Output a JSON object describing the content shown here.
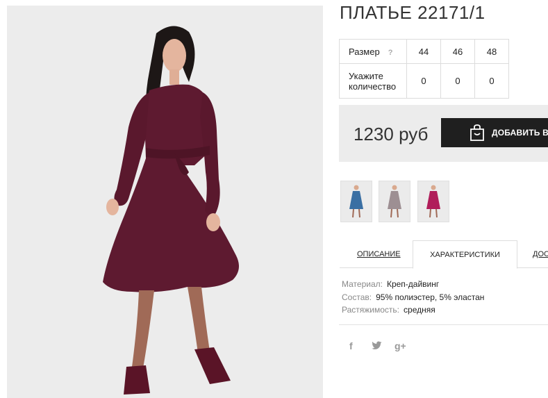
{
  "product": {
    "title": "ПЛАТЬЕ 22171/1"
  },
  "sizes": {
    "size_label": "Размер",
    "help_icon": "?",
    "columns": [
      "44",
      "46",
      "48"
    ],
    "qty_label": "Укажите количество",
    "quantities": [
      "0",
      "0",
      "0"
    ]
  },
  "purchase": {
    "price": "1230 руб",
    "add_to_cart_label": "ДОБАВИТЬ В З",
    "bag_icon": "shopping-bag-icon"
  },
  "color_variants": [
    {
      "name": "blue",
      "color": "#3a6fa3"
    },
    {
      "name": "grey",
      "color": "#9d8f93"
    },
    {
      "name": "magenta",
      "color": "#b01d5a"
    }
  ],
  "tabs": {
    "description": "ОПИСАНИЕ",
    "characteristics": "ХАРАКТЕРИСТИКИ",
    "more": "ДОС"
  },
  "specs": [
    {
      "key": "Материал:",
      "value": "Креп-дайвинг"
    },
    {
      "key": "Состав:",
      "value": "95% полиэстер, 5% эластан"
    },
    {
      "key": "Растяжимость:",
      "value": "средняя"
    }
  ],
  "social": {
    "facebook": "f",
    "twitter": "twitter-icon",
    "googleplus": "g+"
  },
  "colors": {
    "dress": "#5e1a30",
    "price_bar": "#ececec",
    "button": "#1f1f1f"
  }
}
